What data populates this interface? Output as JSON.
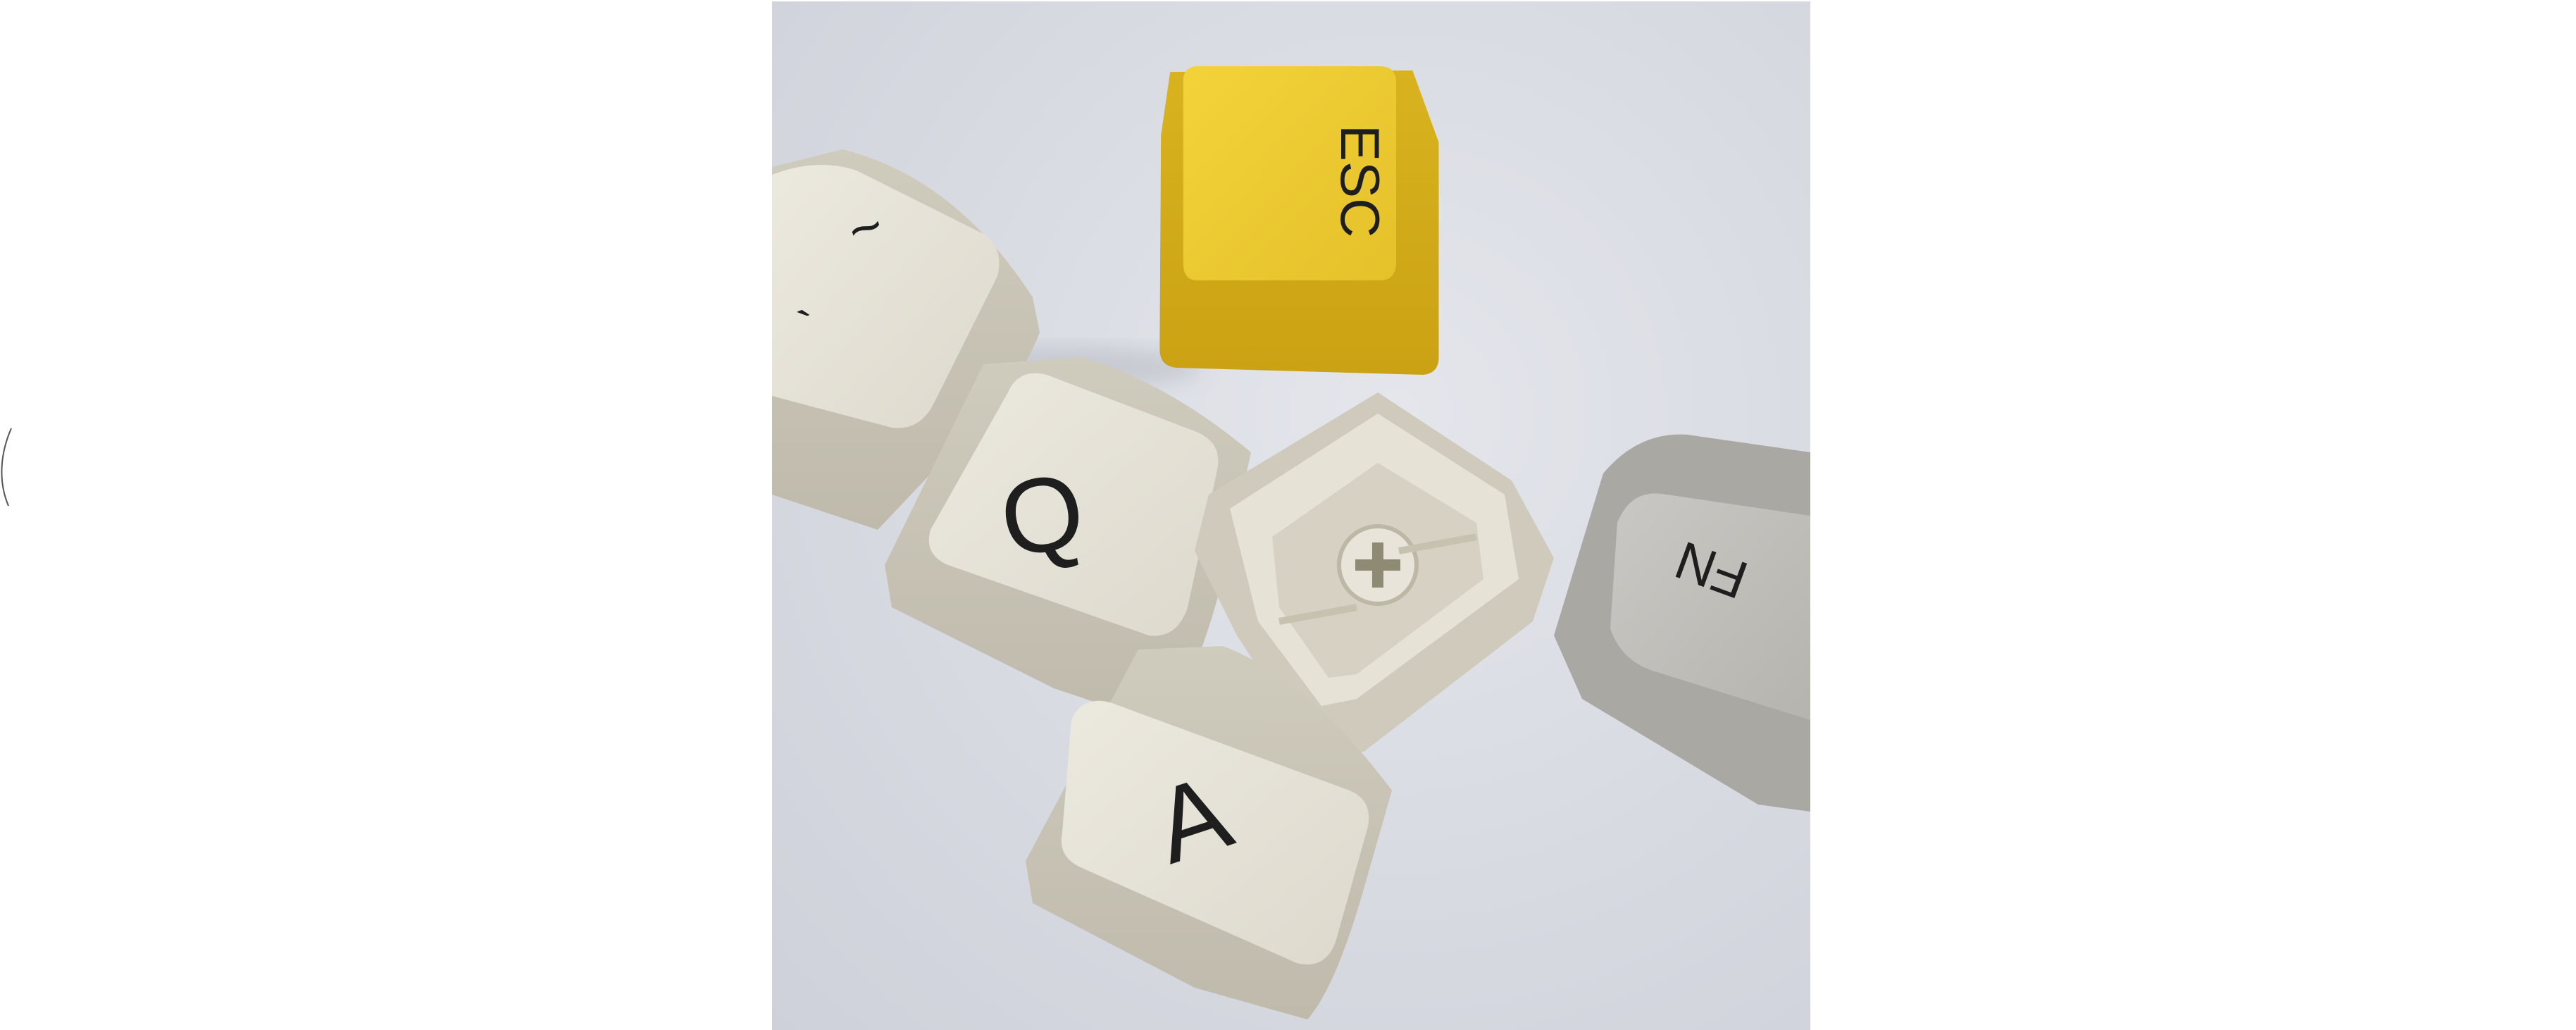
{
  "photo": {
    "subject": "keycaps",
    "keycaps": [
      {
        "legend": "ESC",
        "color": "#e6c02c",
        "icon": "esc-keycap"
      },
      {
        "legend_top": "~",
        "legend_bottom": "`",
        "color": "#dad6ca",
        "icon": "tilde-keycap"
      },
      {
        "legend": "Q",
        "color": "#e2ded2",
        "icon": "q-keycap"
      },
      {
        "legend": "",
        "color": "#e0dccf",
        "icon": "keycap-underside"
      },
      {
        "legend": "A",
        "color": "#e2ded2",
        "icon": "a-keycap"
      },
      {
        "legend": "FN",
        "color": "#b9b8b3",
        "icon": "fn-keycap"
      }
    ],
    "background_color": "#d9dbe2"
  }
}
